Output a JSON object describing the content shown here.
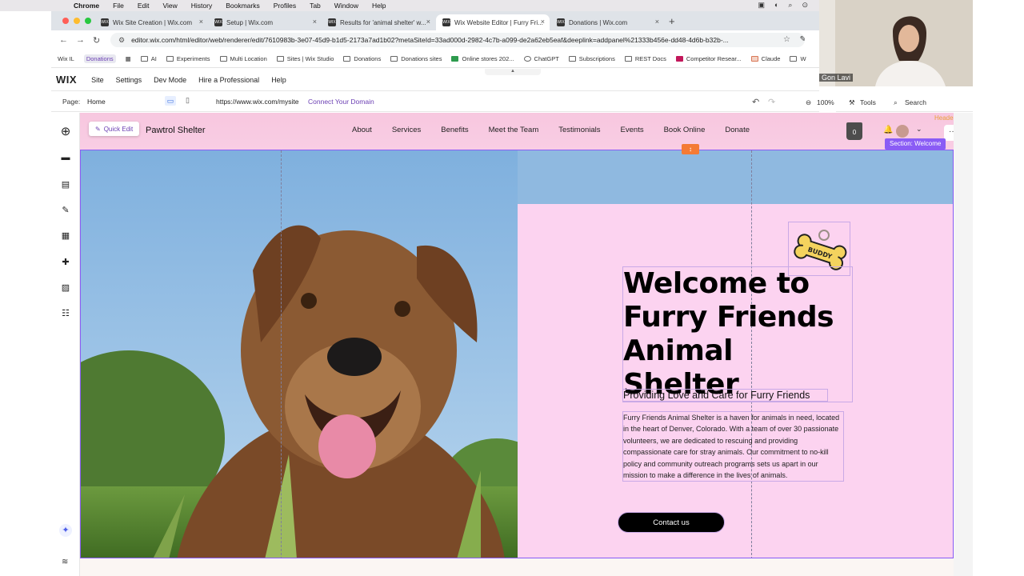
{
  "mac_menu": {
    "app": "Chrome",
    "items": [
      "File",
      "Edit",
      "View",
      "History",
      "Bookmarks",
      "Profiles",
      "Tab",
      "Window",
      "Help"
    ]
  },
  "browser": {
    "tabs": [
      {
        "title": "Wix Site Creation | Wix.com"
      },
      {
        "title": "Setup | Wix.com"
      },
      {
        "title": "Results for 'animal shelter' w..."
      },
      {
        "title": "Wix Website Editor | Furry Fri..."
      },
      {
        "title": "Donations | Wix.com"
      }
    ],
    "url": "editor.wix.com/html/editor/web/renderer/edit/7610983b-3e07-45d9-b1d5-2173a7ad1b02?metaSiteId=33ad000d-2982-4c7b-a099-de2a62eb5eaf&deeplink=addpanel%21333b456e-dd48-4d6b-b32b-...",
    "bookmarks": [
      "Wix IL",
      "Donations",
      "AI",
      "Experiments",
      "Multi Location",
      "Sites | Wix Studio",
      "Donations",
      "Donations sites",
      "Online stores 202...",
      "ChatGPT",
      "Subscriptions",
      "REST Docs",
      "Competitor Resear...",
      "Claude",
      "W"
    ]
  },
  "wix_topbar": {
    "logo": "WIX",
    "menu": [
      "Site",
      "Settings",
      "Dev Mode",
      "Hire a Professional",
      "Help"
    ]
  },
  "page_bar": {
    "page_label": "Page:",
    "page_value": "Home",
    "site_url": "https://www.wix.com/mysite",
    "connect_domain": "Connect Your Domain",
    "zoom": "100%",
    "tools": "Tools",
    "search": "Search"
  },
  "canvas": {
    "quick_edit": "Quick Edit",
    "brand": "Pawtrol Shelter",
    "nav": [
      "About",
      "Services",
      "Benefits",
      "Meet the Team",
      "Testimonials",
      "Events",
      "Book Online",
      "Donate"
    ],
    "cart_count": "0",
    "header_label": "Header",
    "section_label": "Section: Welcome",
    "bone_tag": "BUDDY",
    "heading": "Welcome to\nFurry Friends\nAnimal Shelter",
    "subheading": "Providing Love and Care for Furry Friends",
    "paragraph": "Furry Friends Animal Shelter is a haven for animals in need, located in the heart of Denver, Colorado. With a team of over 30 passionate volunteers, we are dedicated to rescuing and providing compassionate care for stray animals. Our commitment to no-kill policy and community outreach programs sets us apart in our mission to make a difference in the lives of animals.",
    "cta": "Contact us"
  },
  "camera": {
    "name": "Gon Lavi"
  },
  "colors": {
    "header_pink": "#f9cde4",
    "panel_pink": "#fcd3f0",
    "accent_purple": "#8a5cf5",
    "wix_purple_link": "#6b3fb3",
    "cta_black": "#000000",
    "handle_orange": "#f47b35"
  }
}
